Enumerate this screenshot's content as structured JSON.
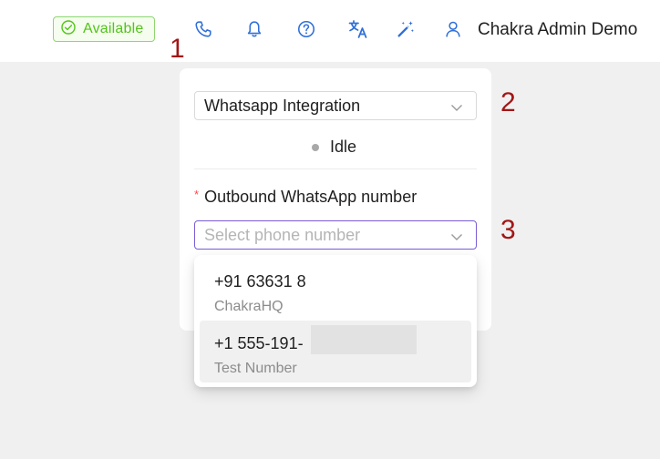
{
  "header": {
    "status_label": "Available",
    "user_name": "Chakra Admin Demo",
    "icons": [
      "phone-icon",
      "bell-icon",
      "help-icon",
      "translate-icon",
      "magic-wand-icon",
      "user-icon"
    ]
  },
  "annotations": [
    "1",
    "2",
    "3"
  ],
  "panel": {
    "integration_value": "Whatsapp Integration",
    "status_text": "Idle",
    "field_required_mark": "*",
    "field_label": "Outbound WhatsApp number",
    "phone_placeholder": "Select phone number",
    "options": [
      {
        "number": "+91 63631 8",
        "label": "ChakraHQ"
      },
      {
        "number": "+1 555-191-",
        "label": "Test Number"
      }
    ]
  },
  "colors": {
    "accent": "#2f6fd9",
    "status_green": "#52c41a",
    "annotation_red": "#a11616",
    "focus_border": "#7b5cd6"
  }
}
